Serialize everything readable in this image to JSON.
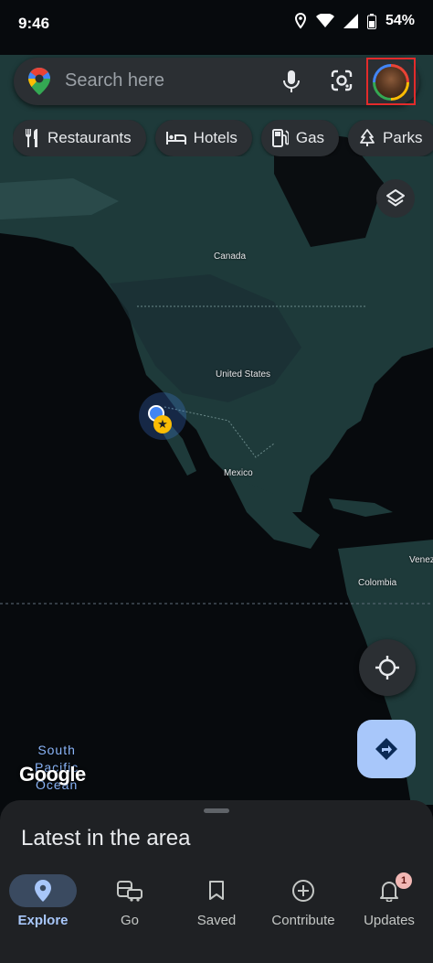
{
  "status_bar": {
    "time": "9:46",
    "battery": "54%"
  },
  "search": {
    "placeholder": "Search here"
  },
  "chips": [
    {
      "label": "Restaurants",
      "icon": "fork-knife-icon"
    },
    {
      "label": "Hotels",
      "icon": "bed-icon"
    },
    {
      "label": "Gas",
      "icon": "gas-pump-icon"
    },
    {
      "label": "Parks",
      "icon": "tree-icon"
    }
  ],
  "map": {
    "labels": {
      "canada": "Canada",
      "usa": "United States",
      "mexico": "Mexico",
      "colombia": "Colombia",
      "venezuela": "Venez"
    },
    "ocean_lines": [
      "South",
      "Pacific",
      "Ocean"
    ],
    "logo": "Google"
  },
  "sheet": {
    "title": "Latest in the area"
  },
  "nav": [
    {
      "label": "Explore",
      "icon": "location-pin-icon",
      "active": true
    },
    {
      "label": "Go",
      "icon": "commute-icon",
      "active": false
    },
    {
      "label": "Saved",
      "icon": "bookmark-icon",
      "active": false
    },
    {
      "label": "Contribute",
      "icon": "add-circle-icon",
      "active": false
    },
    {
      "label": "Updates",
      "icon": "bell-icon",
      "active": false,
      "badge": "1"
    }
  ],
  "colors": {
    "accent": "#a8c7fa",
    "highlight_box": "#e32b2b",
    "map_land": "#1f3d3d"
  }
}
